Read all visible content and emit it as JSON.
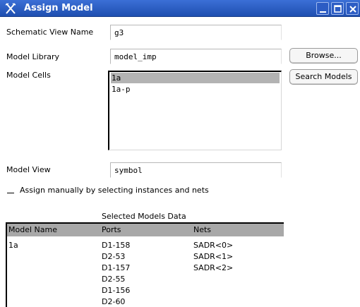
{
  "window": {
    "title": "Assign Model",
    "accent": "#2a5bc2"
  },
  "form": {
    "schematic_view_label": "Schematic View Name",
    "schematic_view_value": "g3",
    "model_library_label": "Model Library",
    "model_library_value": "model_imp",
    "model_cells_label": "Model Cells",
    "model_cells": [
      "1a",
      "1a-p"
    ],
    "model_cells_selected": "1a",
    "model_view_label": "Model View",
    "model_view_value": "symbol",
    "assign_manually_label": "Assign manually by selecting instances and nets"
  },
  "buttons": {
    "browse": "Browse...",
    "search_models": "Search Models"
  },
  "table": {
    "caption": "Selected Models Data",
    "headers": [
      "Model Name",
      "Ports",
      "Nets"
    ],
    "model_name": "1a",
    "ports": [
      "D1-158",
      "D2-53",
      "D1-157",
      "D2-55",
      "D1-156",
      "D2-60"
    ],
    "nets": [
      "SADR<0>",
      "SADR<1>",
      "SADR<2>"
    ]
  },
  "icons": [
    "app-icon",
    "minimize-icon",
    "maximize-icon",
    "close-icon"
  ]
}
